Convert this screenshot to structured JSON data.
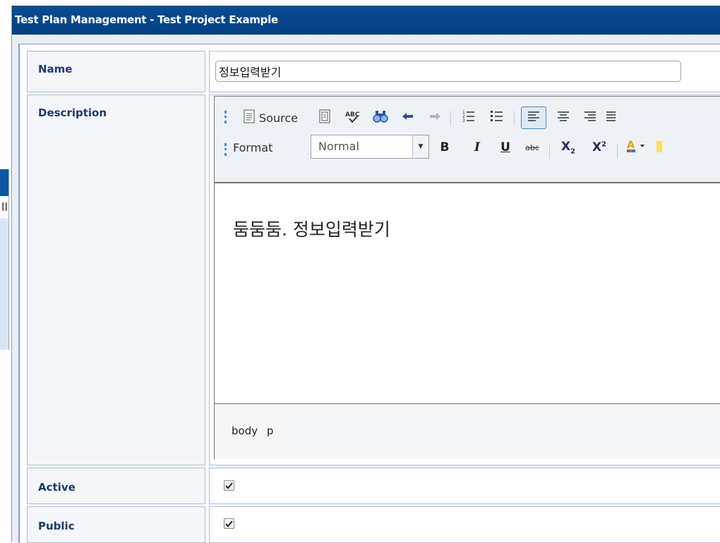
{
  "window": {
    "title": "Test Plan Management - Test Project Example"
  },
  "background_window": {
    "partial_glyph": "ll"
  },
  "form": {
    "name": {
      "label": "Name",
      "value": "정보입력받기"
    },
    "description": {
      "label": "Description",
      "editor": {
        "toolbar1": {
          "source_label": "Source",
          "icons": [
            "source-icon",
            "templates-icon",
            "spellcheck-icon",
            "find-icon",
            "undo-icon",
            "redo-icon",
            "numbered-list-icon",
            "bulleted-list-icon",
            "align-left-icon",
            "align-center-icon",
            "align-right-icon",
            "justify-icon"
          ],
          "active": "align-left-icon"
        },
        "toolbar2": {
          "format_label": "Format",
          "format_value": "Normal",
          "icons": [
            "bold-icon",
            "italic-icon",
            "underline-icon",
            "strikethrough-icon",
            "subscript-icon",
            "superscript-icon",
            "text-color-icon",
            "background-color-icon"
          ]
        },
        "content": "둠둠둠. 정보입력받기",
        "path": "body p"
      }
    },
    "active": {
      "label": "Active",
      "checked": true
    },
    "public": {
      "label": "Public",
      "checked": true
    }
  },
  "colors": {
    "titlebar": "#034184",
    "label_text": "#1d3c6a",
    "label_bg": "#f4f6f9",
    "border": "#a9bcd5",
    "accent_blue": "#4a86c7"
  }
}
